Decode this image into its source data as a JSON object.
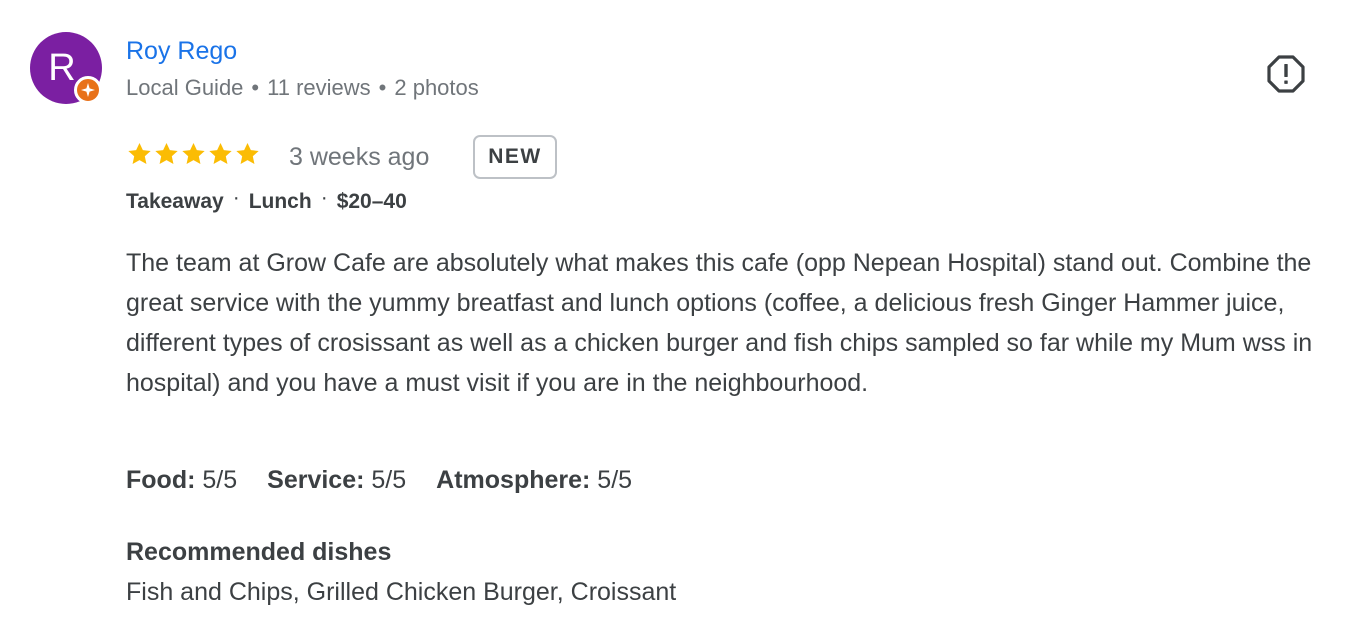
{
  "reviewer": {
    "initial": "R",
    "name": "Roy Rego",
    "badge": "Local Guide",
    "reviews": "11 reviews",
    "photos": "2 photos",
    "avatar_color": "#7b1fa2",
    "badge_color": "#e8711a"
  },
  "review": {
    "stars": 5,
    "time": "3 weeks ago",
    "new_label": "NEW",
    "tags": [
      "Takeaway",
      "Lunch",
      "$20–40"
    ],
    "text": "The team at Grow Cafe are absolutely what makes this cafe (opp Nepean Hospital) stand out. Combine the great service with the yummy breatfast and lunch options (coffee, a delicious fresh Ginger Hammer juice, different types of crosissant as well as a chicken burger and fish chips sampled so far while my Mum wss in hospital) and you have a must visit if you are in the neighbourhood.",
    "ratings": [
      {
        "label": "Food:",
        "value": "5/5"
      },
      {
        "label": "Service:",
        "value": "5/5"
      },
      {
        "label": "Atmosphere:",
        "value": "5/5"
      }
    ],
    "recommended_title": "Recommended dishes",
    "recommended_dishes": "Fish and Chips, Grilled Chicken Burger, Croissant"
  },
  "icons": {
    "star": "star-icon",
    "report": "report-icon",
    "local_guide": "local-guide-icon"
  },
  "colors": {
    "link": "#1a73e8",
    "star": "#fbbc04",
    "muted": "#70757a",
    "text": "#3c4043"
  }
}
